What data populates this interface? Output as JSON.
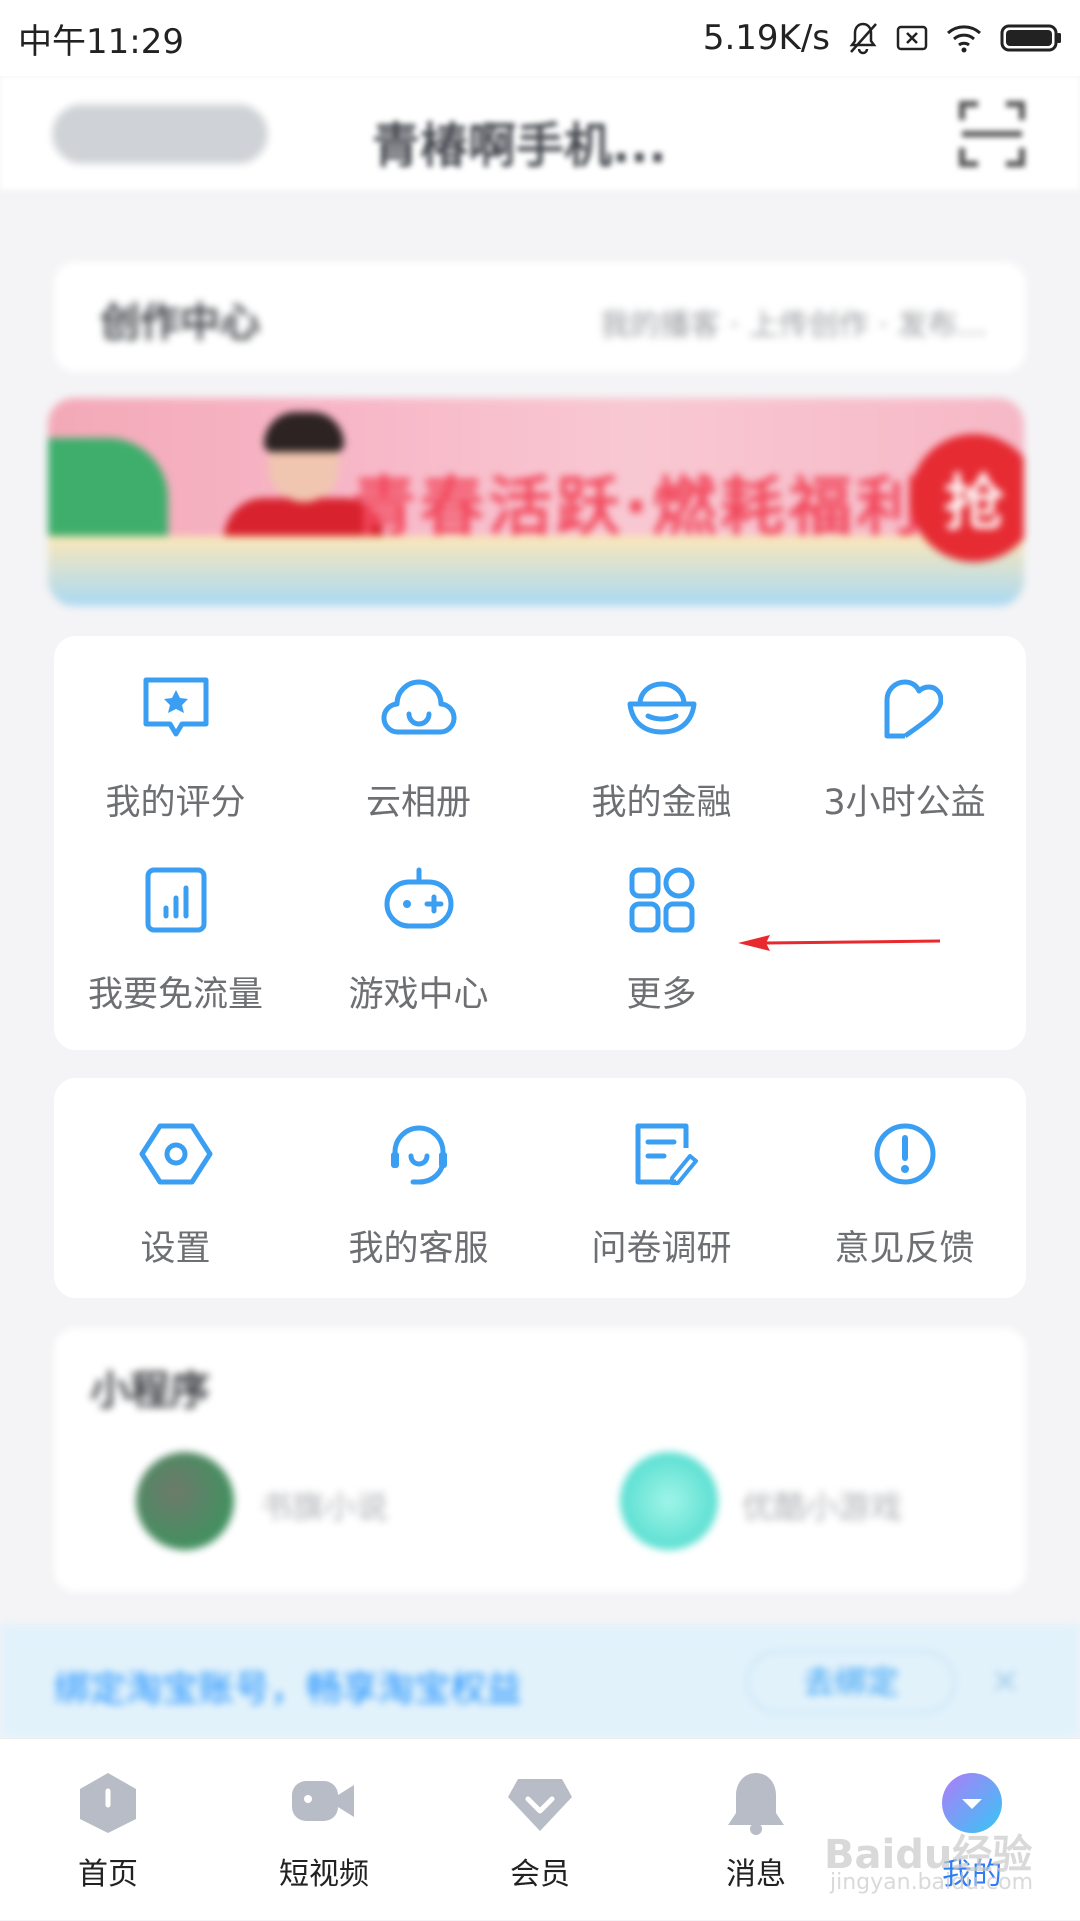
{
  "status_bar": {
    "time": "中午11:29",
    "network_speed": "5.19K/s",
    "icons": [
      "mute-icon",
      "sim-icon",
      "wifi-icon",
      "battery-icon"
    ]
  },
  "header": {
    "title": "青椿啊手机...",
    "vip_badge_icon": "vip-badge-icon",
    "scan_icon": "scan-icon"
  },
  "creator_center": {
    "title": "创作中心",
    "links": "我的播客 · 上传创作 · 发布..."
  },
  "banner": {
    "text": "青春活跃·燃耗福利",
    "badge": "抢"
  },
  "tools": {
    "items": [
      {
        "label": "我的评分",
        "icon": "rating-icon"
      },
      {
        "label": "云相册",
        "icon": "cloud-album-icon"
      },
      {
        "label": "我的金融",
        "icon": "finance-icon"
      },
      {
        "label": "3小时公益",
        "icon": "charity-icon"
      },
      {
        "label": "我要免流量",
        "icon": "free-data-icon"
      },
      {
        "label": "游戏中心",
        "icon": "game-center-icon"
      },
      {
        "label": "更多",
        "icon": "more-grid-icon"
      }
    ]
  },
  "settings": {
    "items": [
      {
        "label": "设置",
        "icon": "settings-icon"
      },
      {
        "label": "我的客服",
        "icon": "customer-service-icon"
      },
      {
        "label": "问卷调研",
        "icon": "survey-icon"
      },
      {
        "label": "意见反馈",
        "icon": "feedback-icon"
      }
    ]
  },
  "mini_programs": {
    "title": "小程序",
    "items": [
      {
        "label": "书旗小说"
      },
      {
        "label": "优酷小游戏"
      }
    ]
  },
  "notice": {
    "text": "绑定淘宝账号，畅享淘宝权益",
    "button": "去绑定",
    "close": "×"
  },
  "tab_bar": {
    "tabs": [
      {
        "label": "首页",
        "icon": "home-icon"
      },
      {
        "label": "短视频",
        "icon": "video-icon"
      },
      {
        "label": "会员",
        "icon": "vip-icon"
      },
      {
        "label": "消息",
        "icon": "bell-icon"
      },
      {
        "label": "我的",
        "icon": "profile-icon"
      }
    ]
  },
  "watermark": {
    "logo": "Baidu经验",
    "url": "jingyan.baidu.com"
  },
  "colors": {
    "accent": "#2f9cf0",
    "icon_blue": "#3a9ef2",
    "arrow_red": "#e8292d",
    "tab_active": "#2f7cf6"
  }
}
